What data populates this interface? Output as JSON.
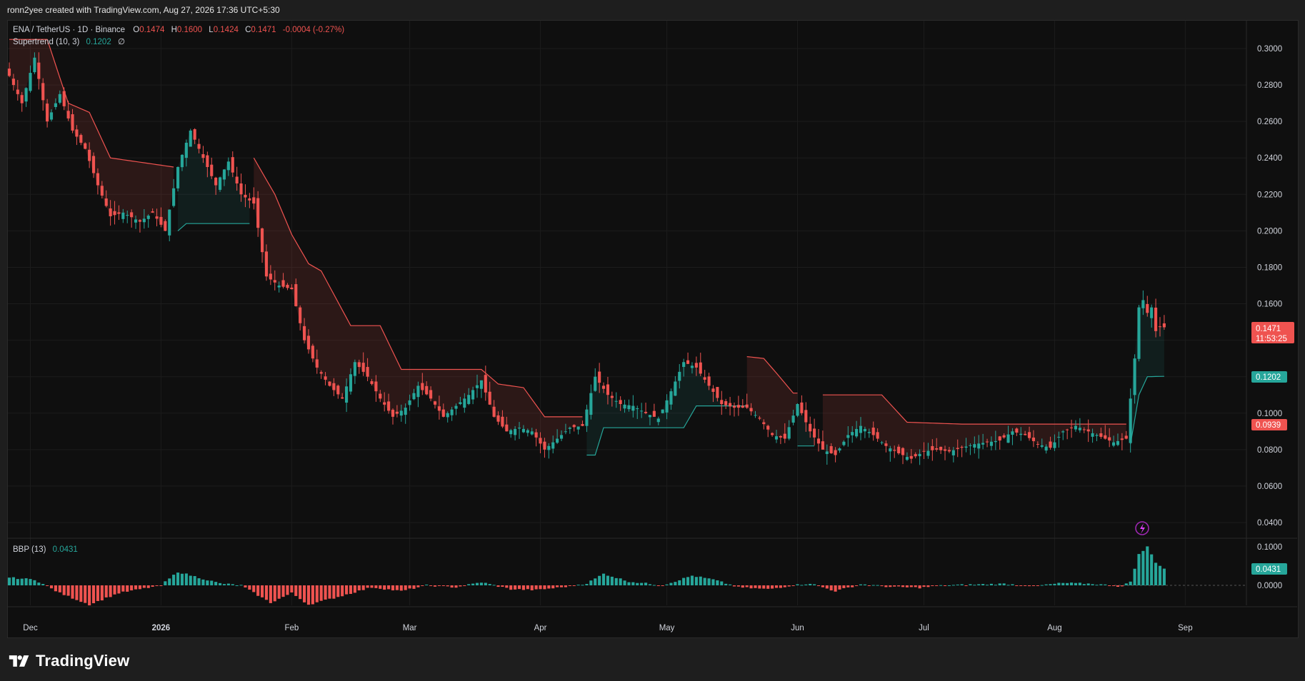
{
  "header": {
    "credit": "ronn2yee created with TradingView.com, Aug 27, 2026 17:36 UTC+5:30"
  },
  "legend": {
    "symbol": "ENA / TetherUS · 1D · Binance",
    "o_label": "O",
    "o": "0.1474",
    "h_label": "H",
    "h": "0.1600",
    "l_label": "L",
    "l": "0.1424",
    "c_label": "C",
    "c": "0.1471",
    "change": "-0.0004 (-0.27%)",
    "supertrend_label": "Supertrend (10, 3)",
    "supertrend_value": "0.1202",
    "supertrend_icon": "∅",
    "bbp_label": "BBP (13)",
    "bbp_value": "0.0431"
  },
  "price_axis": {
    "ticks": [
      "0.3000",
      "0.2800",
      "0.2600",
      "0.2400",
      "0.2200",
      "0.2000",
      "0.1800",
      "0.1600",
      "0.1400",
      "0.1200",
      "0.1000",
      "0.0800",
      "0.0600",
      "0.0400"
    ]
  },
  "bbp_axis": {
    "ticks": [
      "0.1000",
      "0.0000"
    ]
  },
  "time_axis": {
    "labels": [
      "Dec",
      "2026",
      "Feb",
      "Mar",
      "Apr",
      "May",
      "Jun",
      "Jul",
      "Aug",
      "Sep"
    ]
  },
  "badges": {
    "last_price": "0.1471",
    "countdown": "11:53:25",
    "supertrend_price": "0.1202",
    "supertrend_down": "0.0939",
    "bbp_value": "0.0431"
  },
  "colors": {
    "up": "#26a69a",
    "down": "#ef5350",
    "bg": "#0f0f0f",
    "text": "#d1d4dc"
  },
  "footer": {
    "brand": "TradingView",
    "logo_icon": "tradingview-logo-icon"
  },
  "chart_data": {
    "type": "candlestick",
    "interval": "1D",
    "x_range": [
      "2025-11-26",
      "2026-08-27"
    ],
    "y_range": [
      0.03,
      0.31
    ],
    "anchors": [
      [
        "2025-11-26",
        0.285
      ],
      [
        "2025-11-29",
        0.27
      ],
      [
        "2025-12-02",
        0.295
      ],
      [
        "2025-12-05",
        0.26
      ],
      [
        "2025-12-08",
        0.275
      ],
      [
        "2025-12-11",
        0.255
      ],
      [
        "2025-12-14",
        0.245
      ],
      [
        "2025-12-17",
        0.225
      ],
      [
        "2025-12-20",
        0.208
      ],
      [
        "2025-12-23",
        0.21
      ],
      [
        "2025-12-27",
        0.205
      ],
      [
        "2025-12-30",
        0.21
      ],
      [
        "2026-01-02",
        0.2
      ],
      [
        "2026-01-05",
        0.235
      ],
      [
        "2026-01-08",
        0.255
      ],
      [
        "2026-01-11",
        0.24
      ],
      [
        "2026-01-14",
        0.225
      ],
      [
        "2026-01-17",
        0.238
      ],
      [
        "2026-01-20",
        0.22
      ],
      [
        "2026-01-23",
        0.215
      ],
      [
        "2026-01-26",
        0.175
      ],
      [
        "2026-01-29",
        0.17
      ],
      [
        "2026-02-01",
        0.168
      ],
      [
        "2026-02-04",
        0.14
      ],
      [
        "2026-02-07",
        0.125
      ],
      [
        "2026-02-10",
        0.115
      ],
      [
        "2026-02-13",
        0.108
      ],
      [
        "2026-02-16",
        0.128
      ],
      [
        "2026-02-19",
        0.12
      ],
      [
        "2026-02-22",
        0.108
      ],
      [
        "2026-02-25",
        0.098
      ],
      [
        "2026-02-28",
        0.103
      ],
      [
        "2026-03-03",
        0.115
      ],
      [
        "2026-03-06",
        0.108
      ],
      [
        "2026-03-09",
        0.098
      ],
      [
        "2026-03-12",
        0.104
      ],
      [
        "2026-03-15",
        0.11
      ],
      [
        "2026-03-18",
        0.118
      ],
      [
        "2026-03-21",
        0.098
      ],
      [
        "2026-03-24",
        0.09
      ],
      [
        "2026-03-27",
        0.092
      ],
      [
        "2026-03-30",
        0.09
      ],
      [
        "2026-04-02",
        0.08
      ],
      [
        "2026-04-05",
        0.086
      ],
      [
        "2026-04-08",
        0.092
      ],
      [
        "2026-04-11",
        0.093
      ],
      [
        "2026-04-14",
        0.12
      ],
      [
        "2026-04-17",
        0.11
      ],
      [
        "2026-04-20",
        0.105
      ],
      [
        "2026-04-23",
        0.104
      ],
      [
        "2026-04-26",
        0.1
      ],
      [
        "2026-04-29",
        0.097
      ],
      [
        "2026-05-02",
        0.112
      ],
      [
        "2026-05-05",
        0.128
      ],
      [
        "2026-05-08",
        0.125
      ],
      [
        "2026-05-11",
        0.115
      ],
      [
        "2026-05-14",
        0.105
      ],
      [
        "2026-05-17",
        0.103
      ],
      [
        "2026-05-20",
        0.103
      ],
      [
        "2026-05-23",
        0.097
      ],
      [
        "2026-05-26",
        0.088
      ],
      [
        "2026-05-29",
        0.086
      ],
      [
        "2026-06-01",
        0.105
      ],
      [
        "2026-06-04",
        0.09
      ],
      [
        "2026-06-07",
        0.08
      ],
      [
        "2026-06-10",
        0.077
      ],
      [
        "2026-06-13",
        0.088
      ],
      [
        "2026-06-16",
        0.093
      ],
      [
        "2026-06-19",
        0.088
      ],
      [
        "2026-06-22",
        0.082
      ],
      [
        "2026-06-25",
        0.078
      ],
      [
        "2026-06-28",
        0.075
      ],
      [
        "2026-07-01",
        0.079
      ],
      [
        "2026-07-04",
        0.08
      ],
      [
        "2026-07-07",
        0.079
      ],
      [
        "2026-07-10",
        0.081
      ],
      [
        "2026-07-13",
        0.083
      ],
      [
        "2026-07-16",
        0.084
      ],
      [
        "2026-07-19",
        0.085
      ],
      [
        "2026-07-22",
        0.09
      ],
      [
        "2026-07-25",
        0.088
      ],
      [
        "2026-07-28",
        0.083
      ],
      [
        "2026-07-31",
        0.081
      ],
      [
        "2026-08-03",
        0.09
      ],
      [
        "2026-08-06",
        0.093
      ],
      [
        "2026-08-09",
        0.09
      ],
      [
        "2026-08-12",
        0.087
      ],
      [
        "2026-08-15",
        0.084
      ],
      [
        "2026-08-18",
        0.086
      ],
      [
        "2026-08-20",
        0.13
      ],
      [
        "2026-08-21",
        0.158
      ],
      [
        "2026-08-22",
        0.162
      ],
      [
        "2026-08-23",
        0.155
      ],
      [
        "2026-08-24",
        0.158
      ],
      [
        "2026-08-25",
        0.145
      ],
      [
        "2026-08-26",
        0.1474
      ],
      [
        "2026-08-27",
        0.1471
      ]
    ],
    "supertrend": [
      {
        "trend": "down",
        "from": "2025-11-26",
        "to": "2026-01-04",
        "points": [
          [
            "2025-11-26",
            0.305
          ],
          [
            "2025-12-05",
            0.305
          ],
          [
            "2025-12-10",
            0.27
          ],
          [
            "2025-12-15",
            0.265
          ],
          [
            "2025-12-20",
            0.24
          ],
          [
            "2026-01-04",
            0.235
          ]
        ]
      },
      {
        "trend": "up",
        "from": "2026-01-05",
        "to": "2026-01-22",
        "points": [
          [
            "2026-01-05",
            0.2
          ],
          [
            "2026-01-07",
            0.204
          ],
          [
            "2026-01-22",
            0.204
          ]
        ]
      },
      {
        "trend": "down",
        "from": "2026-01-23",
        "to": "2026-04-11",
        "points": [
          [
            "2026-01-23",
            0.24
          ],
          [
            "2026-01-28",
            0.22
          ],
          [
            "2026-02-01",
            0.198
          ],
          [
            "2026-02-05",
            0.182
          ],
          [
            "2026-02-08",
            0.178
          ],
          [
            "2026-02-15",
            0.148
          ],
          [
            "2026-02-22",
            0.148
          ],
          [
            "2026-02-27",
            0.124
          ],
          [
            "2026-03-18",
            0.124
          ],
          [
            "2026-03-22",
            0.116
          ],
          [
            "2026-03-28",
            0.114
          ],
          [
            "2026-04-02",
            0.098
          ],
          [
            "2026-04-11",
            0.098
          ]
        ]
      },
      {
        "trend": "up",
        "from": "2026-04-12",
        "to": "2026-05-20",
        "points": [
          [
            "2026-04-12",
            0.077
          ],
          [
            "2026-04-14",
            0.077
          ],
          [
            "2026-04-16",
            0.092
          ],
          [
            "2026-05-05",
            0.092
          ],
          [
            "2026-05-08",
            0.104
          ],
          [
            "2026-05-20",
            0.104
          ]
        ]
      },
      {
        "trend": "down",
        "from": "2026-05-20",
        "to": "2026-06-01",
        "points": [
          [
            "2026-05-20",
            0.131
          ],
          [
            "2026-05-24",
            0.13
          ],
          [
            "2026-05-27",
            0.122
          ],
          [
            "2026-05-31",
            0.111
          ],
          [
            "2026-06-01",
            0.111
          ]
        ]
      },
      {
        "trend": "up",
        "from": "2026-06-01",
        "to": "2026-06-05",
        "points": [
          [
            "2026-06-01",
            0.082
          ],
          [
            "2026-06-05",
            0.082
          ]
        ]
      },
      {
        "trend": "down",
        "from": "2026-06-07",
        "to": "2026-08-18",
        "points": [
          [
            "2026-06-07",
            0.11
          ],
          [
            "2026-06-21",
            0.11
          ],
          [
            "2026-06-27",
            0.095
          ],
          [
            "2026-07-10",
            0.094
          ],
          [
            "2026-07-25",
            0.094
          ],
          [
            "2026-08-18",
            0.094
          ]
        ]
      },
      {
        "trend": "up",
        "from": "2026-08-19",
        "to": "2026-08-27",
        "points": [
          [
            "2026-08-19",
            0.083
          ],
          [
            "2026-08-21",
            0.11
          ],
          [
            "2026-08-23",
            0.12
          ],
          [
            "2026-08-27",
            0.1202
          ]
        ]
      }
    ],
    "bbp_range": [
      -0.07,
      0.11
    ],
    "bbp_anchors": [
      [
        "2025-11-26",
        0.02
      ],
      [
        "2025-12-02",
        0.015
      ],
      [
        "2025-12-08",
        -0.02
      ],
      [
        "2025-12-15",
        -0.05
      ],
      [
        "2025-12-22",
        -0.02
      ],
      [
        "2026-01-01",
        0.0
      ],
      [
        "2026-01-05",
        0.035
      ],
      [
        "2026-01-10",
        0.02
      ],
      [
        "2026-01-15",
        0.005
      ],
      [
        "2026-01-20",
        0.0
      ],
      [
        "2026-01-27",
        -0.045
      ],
      [
        "2026-02-01",
        -0.02
      ],
      [
        "2026-02-05",
        -0.05
      ],
      [
        "2026-02-12",
        -0.03
      ],
      [
        "2026-02-20",
        -0.005
      ],
      [
        "2026-02-27",
        -0.015
      ],
      [
        "2026-03-05",
        0.0
      ],
      [
        "2026-03-12",
        -0.005
      ],
      [
        "2026-03-18",
        0.008
      ],
      [
        "2026-03-25",
        -0.01
      ],
      [
        "2026-03-31",
        -0.012
      ],
      [
        "2026-04-06",
        -0.005
      ],
      [
        "2026-04-12",
        0.005
      ],
      [
        "2026-04-16",
        0.03
      ],
      [
        "2026-04-22",
        0.01
      ],
      [
        "2026-04-30",
        0.0
      ],
      [
        "2026-05-07",
        0.025
      ],
      [
        "2026-05-12",
        0.015
      ],
      [
        "2026-05-18",
        -0.005
      ],
      [
        "2026-05-25",
        -0.01
      ],
      [
        "2026-05-31",
        0.0
      ],
      [
        "2026-06-04",
        0.005
      ],
      [
        "2026-06-10",
        -0.015
      ],
      [
        "2026-06-16",
        0.003
      ],
      [
        "2026-06-23",
        -0.004
      ],
      [
        "2026-06-30",
        -0.006
      ],
      [
        "2026-07-06",
        0.0
      ],
      [
        "2026-07-13",
        0.002
      ],
      [
        "2026-07-20",
        0.004
      ],
      [
        "2026-07-27",
        -0.002
      ],
      [
        "2026-08-03",
        0.006
      ],
      [
        "2026-08-10",
        0.004
      ],
      [
        "2026-08-17",
        -0.003
      ],
      [
        "2026-08-19",
        0.01
      ],
      [
        "2026-08-21",
        0.08
      ],
      [
        "2026-08-23",
        0.1
      ],
      [
        "2026-08-25",
        0.06
      ],
      [
        "2026-08-27",
        0.0431
      ]
    ]
  }
}
